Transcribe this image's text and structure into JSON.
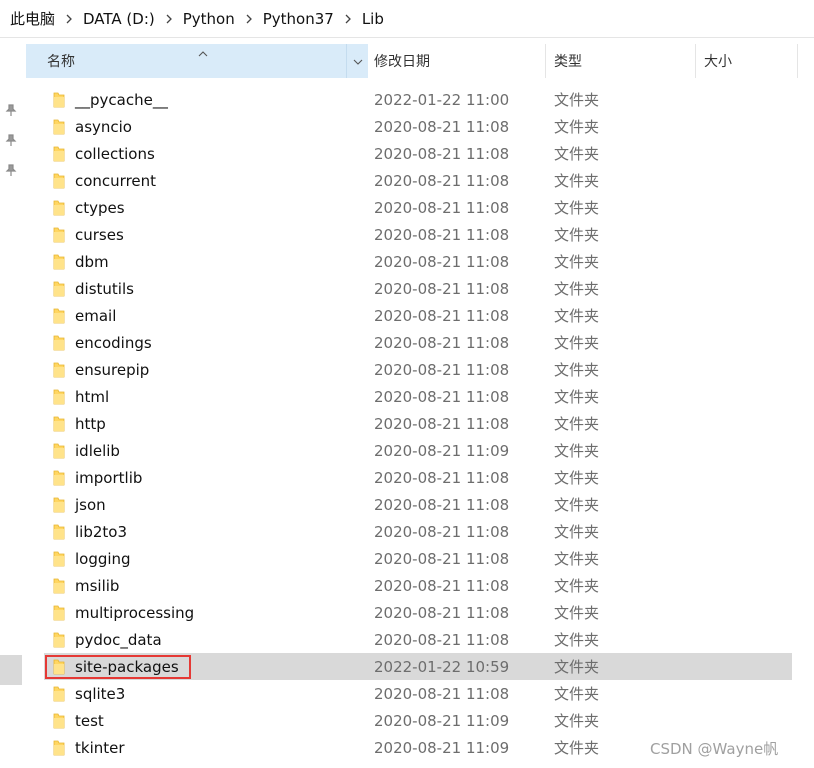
{
  "breadcrumb": [
    "此电脑",
    "DATA (D:)",
    "Python",
    "Python37",
    "Lib"
  ],
  "columns": {
    "name": "名称",
    "date": "修改日期",
    "type": "类型",
    "size": "大小"
  },
  "rows": [
    {
      "name": "__pycache__",
      "date": "2022-01-22 11:00",
      "type": "文件夹"
    },
    {
      "name": "asyncio",
      "date": "2020-08-21 11:08",
      "type": "文件夹"
    },
    {
      "name": "collections",
      "date": "2020-08-21 11:08",
      "type": "文件夹"
    },
    {
      "name": "concurrent",
      "date": "2020-08-21 11:08",
      "type": "文件夹"
    },
    {
      "name": "ctypes",
      "date": "2020-08-21 11:08",
      "type": "文件夹"
    },
    {
      "name": "curses",
      "date": "2020-08-21 11:08",
      "type": "文件夹"
    },
    {
      "name": "dbm",
      "date": "2020-08-21 11:08",
      "type": "文件夹"
    },
    {
      "name": "distutils",
      "date": "2020-08-21 11:08",
      "type": "文件夹"
    },
    {
      "name": "email",
      "date": "2020-08-21 11:08",
      "type": "文件夹"
    },
    {
      "name": "encodings",
      "date": "2020-08-21 11:08",
      "type": "文件夹"
    },
    {
      "name": "ensurepip",
      "date": "2020-08-21 11:08",
      "type": "文件夹"
    },
    {
      "name": "html",
      "date": "2020-08-21 11:08",
      "type": "文件夹"
    },
    {
      "name": "http",
      "date": "2020-08-21 11:08",
      "type": "文件夹"
    },
    {
      "name": "idlelib",
      "date": "2020-08-21 11:09",
      "type": "文件夹"
    },
    {
      "name": "importlib",
      "date": "2020-08-21 11:08",
      "type": "文件夹"
    },
    {
      "name": "json",
      "date": "2020-08-21 11:08",
      "type": "文件夹"
    },
    {
      "name": "lib2to3",
      "date": "2020-08-21 11:08",
      "type": "文件夹"
    },
    {
      "name": "logging",
      "date": "2020-08-21 11:08",
      "type": "文件夹"
    },
    {
      "name": "msilib",
      "date": "2020-08-21 11:08",
      "type": "文件夹"
    },
    {
      "name": "multiprocessing",
      "date": "2020-08-21 11:08",
      "type": "文件夹"
    },
    {
      "name": "pydoc_data",
      "date": "2020-08-21 11:08",
      "type": "文件夹"
    },
    {
      "name": "site-packages",
      "date": "2022-01-22 10:59",
      "type": "文件夹",
      "selected": true
    },
    {
      "name": "sqlite3",
      "date": "2020-08-21 11:08",
      "type": "文件夹"
    },
    {
      "name": "test",
      "date": "2020-08-21 11:09",
      "type": "文件夹"
    },
    {
      "name": "tkinter",
      "date": "2020-08-21 11:09",
      "type": "文件夹"
    }
  ],
  "watermark": "CSDN @Wayne帆",
  "icons": {
    "folder": "folder-icon",
    "pin": "pin-icon",
    "chevron": "chevron-right-icon",
    "dropdown": "chevron-down-icon",
    "sort": "sort-up-icon"
  },
  "colors": {
    "header_active": "#d9ebf9",
    "selected_row": "#d9d9d9",
    "annotation": "#e53935",
    "folder": "#ffd662"
  }
}
